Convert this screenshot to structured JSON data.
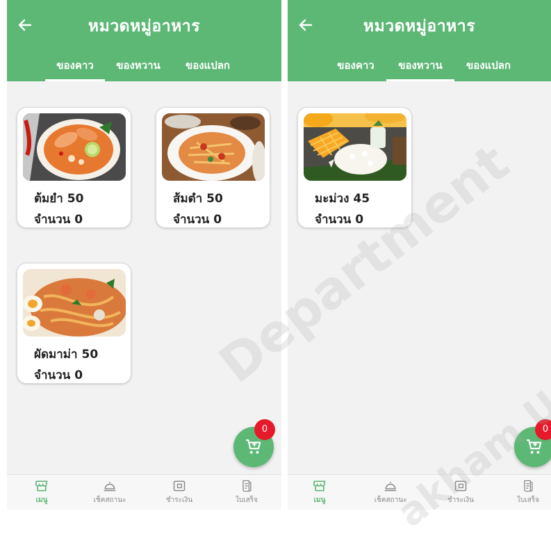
{
  "screens": [
    {
      "title": "หมวดหมู่อาหาร",
      "tabs": [
        {
          "label": "ของคาว",
          "active": true
        },
        {
          "label": "ของหวาน",
          "active": false
        },
        {
          "label": "ของแปลก",
          "active": false
        }
      ],
      "items": [
        {
          "name": "ต้มยำ",
          "price": "50",
          "qty_label": "จำนวน",
          "qty": "0",
          "image": "tom-yum"
        },
        {
          "name": "ส้มตำ",
          "price": "50",
          "qty_label": "จำนวน",
          "qty": "0",
          "image": "som-tam"
        },
        {
          "name": "ผัดมาม่า",
          "price": "50",
          "qty_label": "จำนวน",
          "qty": "0",
          "image": "pad-mama"
        }
      ],
      "cart_badge": "0",
      "nav": [
        {
          "label": "เมนู",
          "icon": "store-icon",
          "active": true
        },
        {
          "label": "เช็คสถานะ",
          "icon": "cloche-icon",
          "active": false
        },
        {
          "label": "ชำระเงิน",
          "icon": "wallet-icon",
          "active": false
        },
        {
          "label": "ใบเสร็จ",
          "icon": "receipt-icon",
          "active": false
        }
      ]
    },
    {
      "title": "หมวดหมู่อาหาร",
      "tabs": [
        {
          "label": "ของคาว",
          "active": false
        },
        {
          "label": "ของหวาน",
          "active": true
        },
        {
          "label": "ของแปลก",
          "active": false
        }
      ],
      "items": [
        {
          "name": "มะม่วง",
          "price": "45",
          "qty_label": "จำนวน",
          "qty": "0",
          "image": "mango-sticky-rice"
        }
      ],
      "cart_badge": "0",
      "nav": [
        {
          "label": "เมนู",
          "icon": "store-icon",
          "active": true
        },
        {
          "label": "เช็คสถานะ",
          "icon": "cloche-icon",
          "active": false
        },
        {
          "label": "ชำระเงิน",
          "icon": "wallet-icon",
          "active": false
        },
        {
          "label": "ใบเสร็จ",
          "icon": "receipt-icon",
          "active": false
        }
      ]
    }
  ],
  "watermark": {
    "line1": "Department",
    "line2": "akham Uni"
  },
  "colors": {
    "primary": "#5db876",
    "badge": "#e61a2a",
    "background": "#f2f2f2"
  }
}
